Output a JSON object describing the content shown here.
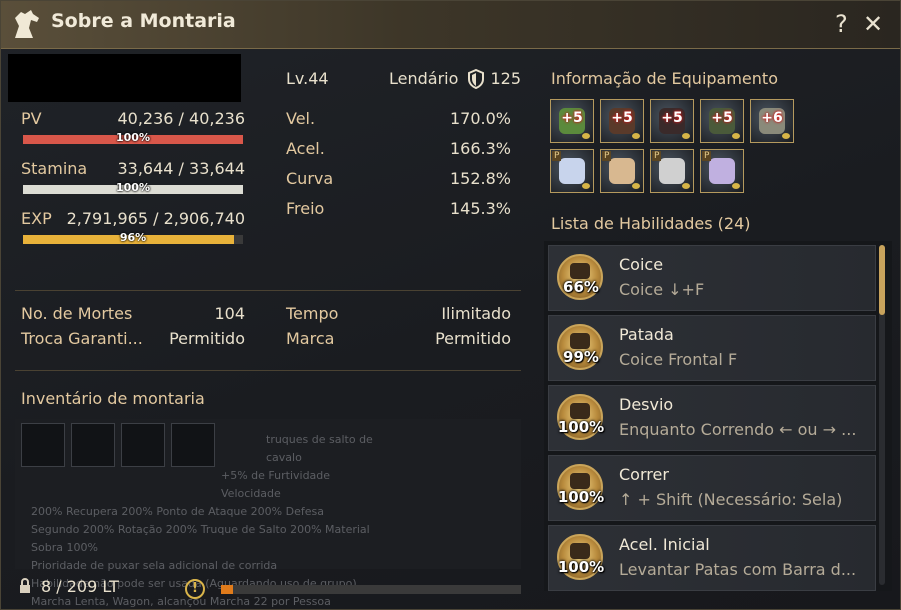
{
  "window": {
    "title": "Sobre a Montaria"
  },
  "stats": {
    "pv_label": "PV",
    "pv_value": "40,236 / 40,236",
    "pv_pct": "100%",
    "pv_fill": 1.0,
    "stamina_label": "Stamina",
    "stamina_value": "33,644 / 33,644",
    "stamina_pct": "100%",
    "stamina_fill": 1.0,
    "exp_label": "EXP",
    "exp_value": "2,791,965 / 2,906,740",
    "exp_pct": "96%",
    "exp_fill": 0.96,
    "level": "Lv.44",
    "grade": "Lendário",
    "armor": "125",
    "vel_label": "Vel.",
    "vel_value": "170.0%",
    "acel_label": "Acel.",
    "acel_value": "166.3%",
    "curva_label": "Curva",
    "curva_value": "152.8%",
    "freio_label": "Freio",
    "freio_value": "145.3%",
    "mortes_label": "No. de Mortes",
    "mortes_value": "104",
    "tempo_label": "Tempo",
    "tempo_value": "Ilimitado",
    "troca_label": "Troca Garanti...",
    "troca_value": "Permitido",
    "marca_label": "Marca",
    "marca_value": "Permitido"
  },
  "inventory": {
    "title": "Inventário de montaria",
    "bg_text": [
      "truques de salto de cavalo",
      "+5% de Furtividade Velocidade",
      "200% Recupera 200% Ponto de Ataque 200% Defesa",
      "Segundo 200% Rotação 200% Truque de Salto 200% Material",
      "Sobra 100%",
      "Prioridade de puxar sela adicional de corrida",
      "Habilidade não pode ser usada (Aguardando uso de grupo)",
      "Marcha Lenta, Wagon, alcançou Marcha 22 por Pessoa"
    ],
    "weight_label": "8 / 209 LT",
    "weight_fill": 0.04,
    "warning_icon": "!"
  },
  "equipment": {
    "title": "Informação de Equipamento",
    "items": [
      {
        "enh": "+5",
        "icon": "gear-icon",
        "tone": "#5b8a3c"
      },
      {
        "enh": "+5",
        "icon": "gear-icon",
        "tone": "#5a3a2a"
      },
      {
        "enh": "+5",
        "icon": "gear-icon",
        "tone": "#3a2a2a"
      },
      {
        "enh": "+5",
        "icon": "gear-icon",
        "tone": "#4a5a3a"
      },
      {
        "enh": "+6",
        "icon": "horseshoe-icon",
        "tone": "#8a8a7a"
      },
      {
        "badge": "P",
        "icon": "costume-icon",
        "tone": "#c8d4ec"
      },
      {
        "badge": "P",
        "icon": "costume-icon",
        "tone": "#d8b890"
      },
      {
        "badge": "P",
        "icon": "costume-icon",
        "tone": "#d0d0d0"
      },
      {
        "badge": "P",
        "icon": "costume-icon",
        "tone": "#c0b0e0"
      }
    ]
  },
  "skills": {
    "title": "Lista de Habilidades (24)",
    "items": [
      {
        "name": "Coice",
        "desc": "Coice ↓+F",
        "pct": "66%"
      },
      {
        "name": "Patada",
        "desc": "Coice Frontal F",
        "pct": "99%"
      },
      {
        "name": "Desvio",
        "desc": "Enquanto Correndo ← ou → ...",
        "pct": "100%"
      },
      {
        "name": "Correr",
        "desc": "↑ + Shift (Necessário: Sela)",
        "pct": "100%"
      },
      {
        "name": "Acel. Inicial",
        "desc": "Levantar Patas com Barra d...",
        "pct": "100%"
      }
    ]
  },
  "colors": {
    "pv": "#d9574a",
    "stamina": "#dcdcd4",
    "exp": "#e8b23a",
    "weight": "#e07b1b",
    "accent": "#c8a35c"
  }
}
